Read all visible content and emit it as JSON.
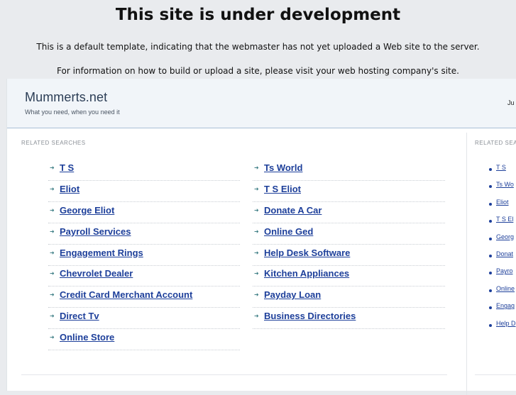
{
  "notice": {
    "title": "This site is under development",
    "line1": "This is a default template, indicating that the webmaster has not yet uploaded a Web site to the server.",
    "line2": "For information on how to build or upload a site, please visit your web hosting company's site."
  },
  "header": {
    "site_name": "Mummerts.net",
    "tagline": "What you need, when you need it",
    "right_text": "Ju"
  },
  "main": {
    "label": "RELATED SEARCHES",
    "arrow_icon": "arrow-right-icon",
    "col1": [
      "T S",
      "Eliot",
      "George Eliot",
      "Payroll Services",
      "Engagement Rings",
      "Chevrolet Dealer",
      "Credit Card Merchant Account",
      "Direct Tv",
      "Online Store"
    ],
    "col2": [
      "Ts World",
      "T S Eliot",
      "Donate A Car",
      "Online Ged",
      "Help Desk Software",
      "Kitchen Appliances",
      "Payday Loan",
      "Business Directories"
    ]
  },
  "sidebar": {
    "label": "RELATED SEA",
    "items": [
      "T S",
      "Ts Wo",
      "Eliot",
      "T S El",
      "Georg",
      "Donat",
      "Payro",
      "Online",
      "Engag",
      "Help D"
    ]
  },
  "colors": {
    "link": "#1d3f9a",
    "header_bg": "#f1f5f9",
    "page_bg": "#e9ebee"
  }
}
